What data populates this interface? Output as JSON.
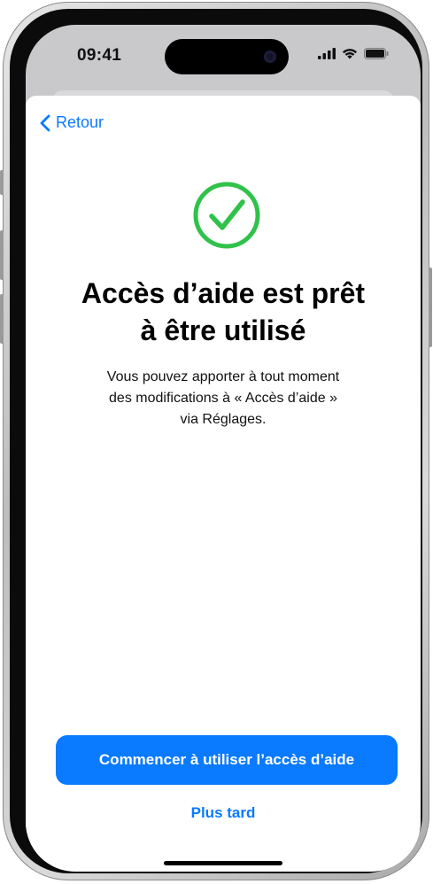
{
  "status_bar": {
    "time": "09:41",
    "icons": [
      "cellular-signal-icon",
      "wifi-icon",
      "battery-icon"
    ]
  },
  "nav": {
    "back_label": "Retour",
    "back_icon": "chevron-left-icon"
  },
  "main": {
    "status_icon": "checkmark-circle-icon",
    "title_line1": "Accès d’aide est prêt",
    "title_line2": "à être utilisé",
    "desc_line1": "Vous pouvez apporter à tout moment",
    "desc_line2": "des modifications à « Accès d’aide »",
    "desc_line3": "via Réglages."
  },
  "actions": {
    "primary_label": "Commencer à utiliser l’accès d’aide",
    "secondary_label": "Plus tard"
  },
  "colors": {
    "accent": "#0a7aff",
    "success": "#30c24a"
  }
}
